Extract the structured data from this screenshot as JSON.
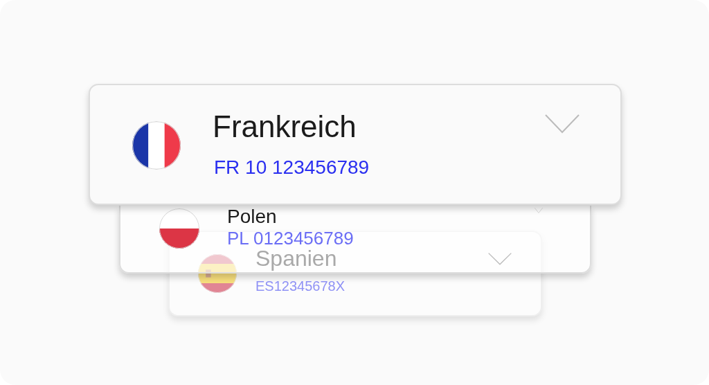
{
  "cards": [
    {
      "country": "Frankreich",
      "vat": "FR 10 123456789"
    },
    {
      "country": "Polen",
      "vat": "PL 0123456789"
    },
    {
      "country": "Spanien",
      "vat": "ES12345678X"
    }
  ]
}
